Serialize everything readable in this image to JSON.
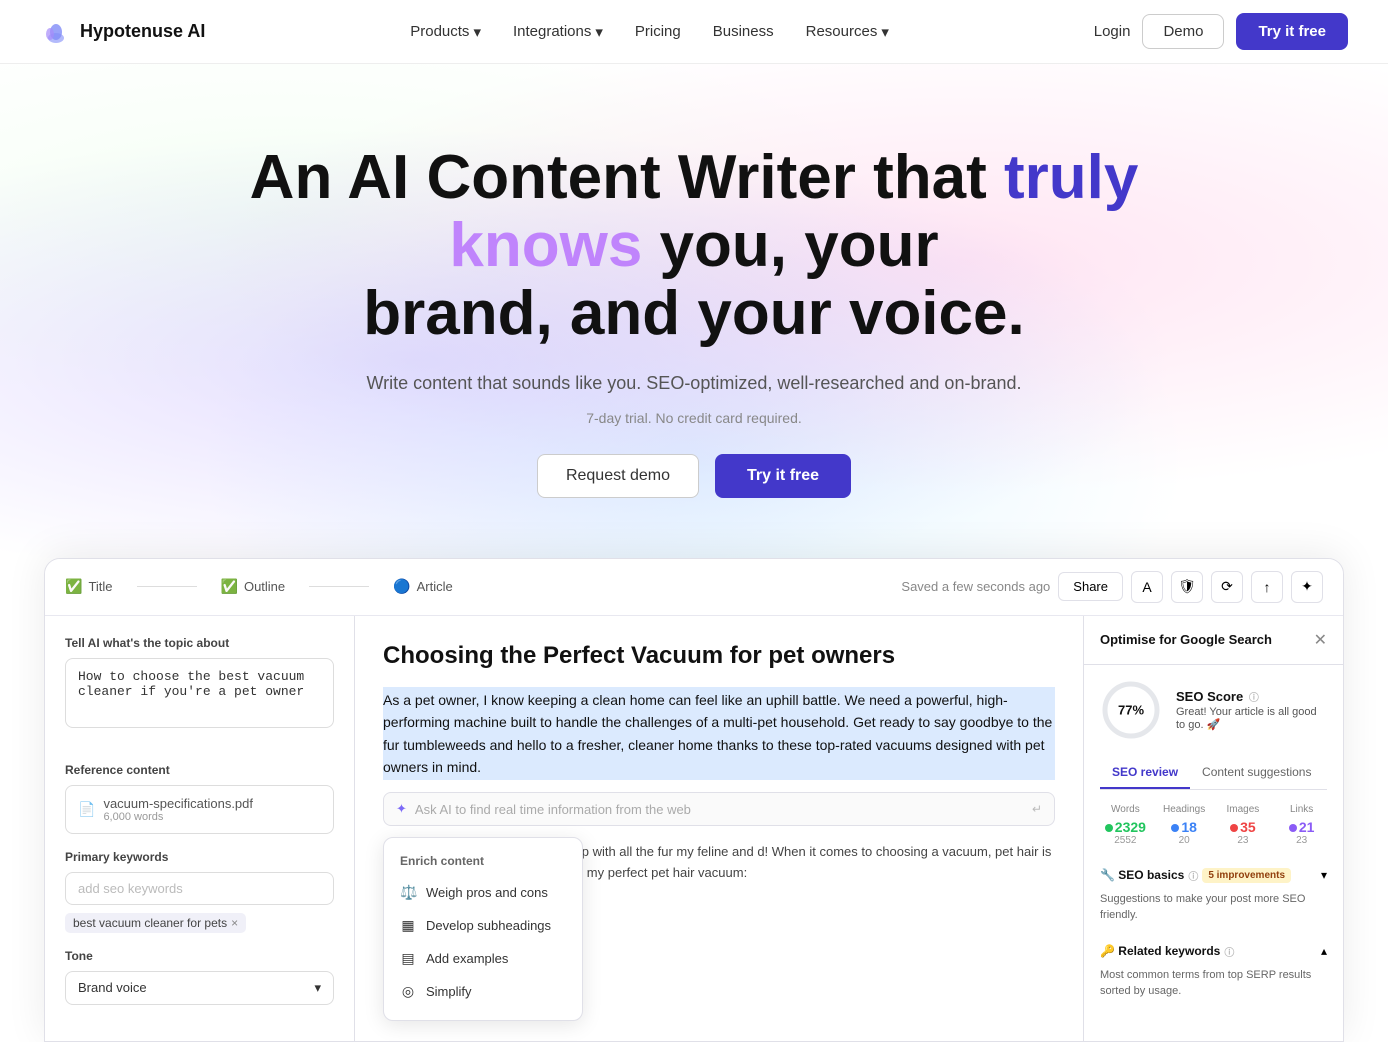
{
  "nav": {
    "logo_text": "Hypotenuse AI",
    "links": [
      {
        "label": "Products",
        "has_dropdown": true
      },
      {
        "label": "Integrations",
        "has_dropdown": true
      },
      {
        "label": "Pricing",
        "has_dropdown": false
      },
      {
        "label": "Business",
        "has_dropdown": false
      },
      {
        "label": "Resources",
        "has_dropdown": true
      }
    ],
    "login_label": "Login",
    "demo_label": "Demo",
    "try_label": "Try it free"
  },
  "hero": {
    "title_part1": "An AI Content Writer that ",
    "title_truly": "truly",
    "title_knows": "knows",
    "title_part2": " you, your brand, and your voice.",
    "subtitle": "Write content that sounds like you. SEO-optimized, well-researched and on-brand.",
    "trial_text": "7-day trial. No credit card required.",
    "btn_demo": "Request demo",
    "btn_try": "Try it free"
  },
  "app": {
    "saved_text": "Saved a few seconds ago",
    "share_label": "Share",
    "steps": [
      {
        "label": "Title",
        "done": true
      },
      {
        "label": "Outline",
        "done": true
      },
      {
        "label": "Article",
        "done": true
      }
    ],
    "left_panel": {
      "topic_label": "Tell AI what's the topic about",
      "topic_value": "How to choose the best vacuum cleaner if you're a pet owner",
      "reference_label": "Reference content",
      "file_name": "vacuum-specifications.pdf",
      "file_size": "6,000 words",
      "keywords_label": "Primary keywords",
      "keyword_placeholder": "add seo keywords",
      "keyword_tag": "best vacuum cleaner for pets",
      "tone_label": "Tone",
      "tone_value": "Brand voice"
    },
    "center": {
      "article_title": "Choosing the Perfect Vacuum for pet owners",
      "highlight_text": "As a pet owner, I know keeping a clean home can feel like an uphill battle. We need a powerful, high-performing machine built to handle the challenges of a multi-pet household. Get ready to say goodbye to the fur tumbleweeds and hello to a fresher, cleaner home thanks to these top-rated vacuums designed with pet owners in mind.",
      "ai_ask_placeholder": "Ask AI to find real time information from the web",
      "body_text": "ch of a struggle it can be to keep up with all the fur my feline and d! When it comes to choosing a vacuum, pet hair is definitely a top hings I looked for in my perfect pet hair vacuum:",
      "enrich": {
        "title": "Enrich content",
        "items": [
          {
            "icon": "⚖️",
            "label": "Weigh pros and cons"
          },
          {
            "icon": "▦",
            "label": "Develop subheadings"
          },
          {
            "icon": "▤",
            "label": "Add examples"
          },
          {
            "icon": "◎",
            "label": "Simplify"
          }
        ]
      }
    },
    "right_panel": {
      "title": "Optimise for Google Search",
      "seo_score": 77,
      "seo_score_label": "SEO Score",
      "seo_score_info": "Great! Your article is all good to go. 🚀",
      "tab_seo": "SEO review",
      "tab_content": "Content suggestions",
      "stats": [
        {
          "label": "Words",
          "value": "2329",
          "sub": "2552",
          "color": "green"
        },
        {
          "label": "Headings",
          "value": "18",
          "sub": "20",
          "color": "blue"
        },
        {
          "label": "Images",
          "value": "35",
          "sub": "23",
          "color": "red"
        },
        {
          "label": "Links",
          "value": "21",
          "sub": "23",
          "color": "purple"
        }
      ],
      "seo_basics_label": "🔧 SEO basics",
      "seo_basics_badge": "5 improvements",
      "seo_basics_desc": "Suggestions to make your post more SEO friendly.",
      "related_keywords_label": "🔑 Related keywords",
      "related_keywords_desc": "Most common terms from top SERP results sorted by usage."
    }
  }
}
